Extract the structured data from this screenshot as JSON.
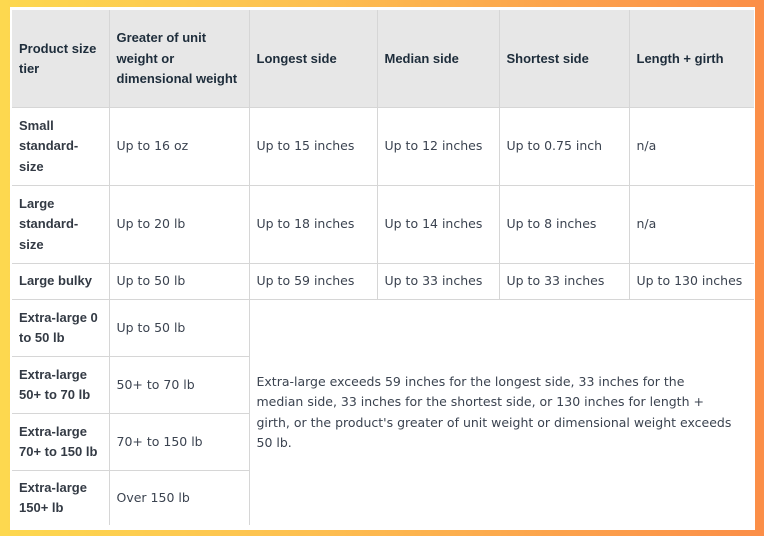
{
  "table": {
    "headers": [
      "Product size tier",
      "Greater of unit weight or dimensional weight",
      "Longest side",
      "Median side",
      "Shortest side",
      "Length + girth"
    ],
    "rows": [
      [
        "Small standard-size",
        "Up to 16 oz",
        "Up to 15 inches",
        "Up to 12 inches",
        "Up to 0.75 inch",
        "n/a"
      ],
      [
        "Large standard-size",
        "Up to 20 lb",
        "Up to 18 inches",
        "Up to 14 inches",
        "Up to 8 inches",
        "n/a"
      ],
      [
        "Large bulky",
        "Up to 50 lb",
        "Up to 59 inches",
        "Up to 33 inches",
        "Up to 33 inches",
        "Up to 130 inches"
      ],
      [
        "Extra-large 0 to 50 lb",
        "Up to 50 lb"
      ],
      [
        "Extra-large 50+ to 70 lb",
        "50+ to 70 lb"
      ],
      [
        "Extra-large 70+ to 150 lb",
        "70+ to 150 lb"
      ],
      [
        "Extra-large 150+ lb",
        "Over 150 lb"
      ]
    ],
    "extra_large_note": "Extra-large exceeds 59 inches for the longest side, 33 inches for the median side, 33 inches for the shortest side, or 130 inches for length + girth, or the product's greater of unit weight or dimensional weight exceeds 50 lb."
  },
  "colors": {
    "background_left": "#fdd84f",
    "background_right": "#fb8e48",
    "header_bg": "#e7e7e7",
    "border": "#d6d6d6"
  }
}
